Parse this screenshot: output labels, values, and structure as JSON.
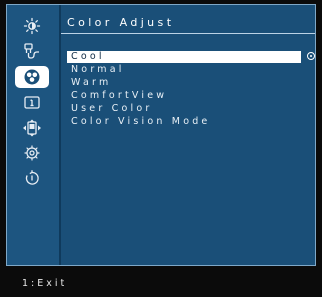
{
  "menu": {
    "title": "Color Adjust",
    "items": [
      {
        "label": "Cool",
        "selected": true
      },
      {
        "label": "Normal",
        "selected": false
      },
      {
        "label": "Warm",
        "selected": false
      },
      {
        "label": "ComfortView",
        "selected": false
      },
      {
        "label": "User Color",
        "selected": false
      },
      {
        "label": "Color Vision Mode",
        "selected": false
      }
    ]
  },
  "sidebar": {
    "icons": [
      {
        "name": "brightness-icon",
        "active": false
      },
      {
        "name": "input-source-icon",
        "active": false
      },
      {
        "name": "color-icon",
        "active": true
      },
      {
        "name": "display-icon",
        "active": false
      },
      {
        "name": "menu-icon",
        "active": false
      },
      {
        "name": "settings-icon",
        "active": false
      },
      {
        "name": "reset-icon",
        "active": false
      }
    ]
  },
  "footer": {
    "exit_label": "1:Exit"
  },
  "colors": {
    "panel": "#1a4f78",
    "sidebar": "#1d5580",
    "highlight": "#ffffff",
    "background": "#0b0b0b"
  }
}
